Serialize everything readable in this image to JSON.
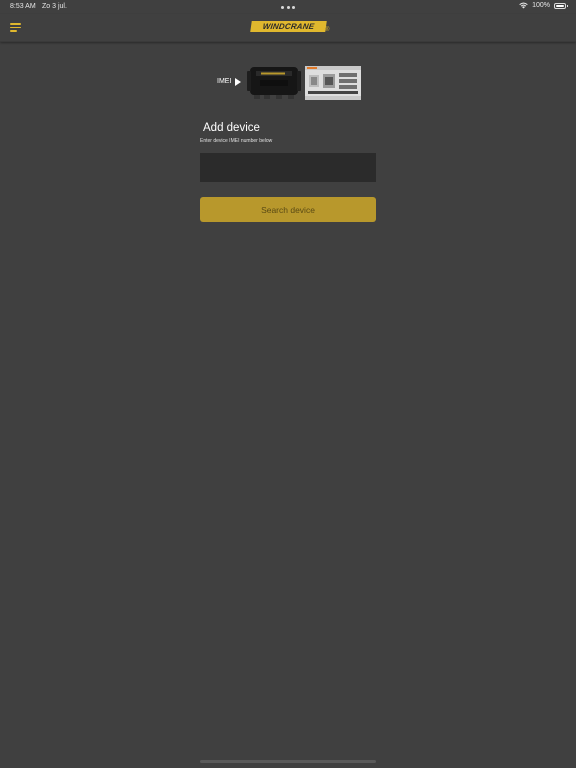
{
  "status_bar": {
    "time": "8:53 AM",
    "date": "Zo 3 jul.",
    "battery": "100%"
  },
  "nav": {
    "logo_text": "WINDCRANE",
    "logo_mark": "®"
  },
  "illustration": {
    "label": "IMEI"
  },
  "form": {
    "title": "Add device",
    "subtitle": "Enter device IMEI number below",
    "input_value": "",
    "input_placeholder": "",
    "button_label": "Search device"
  },
  "colors": {
    "background": "#404040",
    "accent": "#e0b82e",
    "button": "#b8982c",
    "input": "#2b2b2b"
  },
  "icons": [
    "menu-icon",
    "wifi-icon",
    "battery-icon",
    "play-icon"
  ]
}
